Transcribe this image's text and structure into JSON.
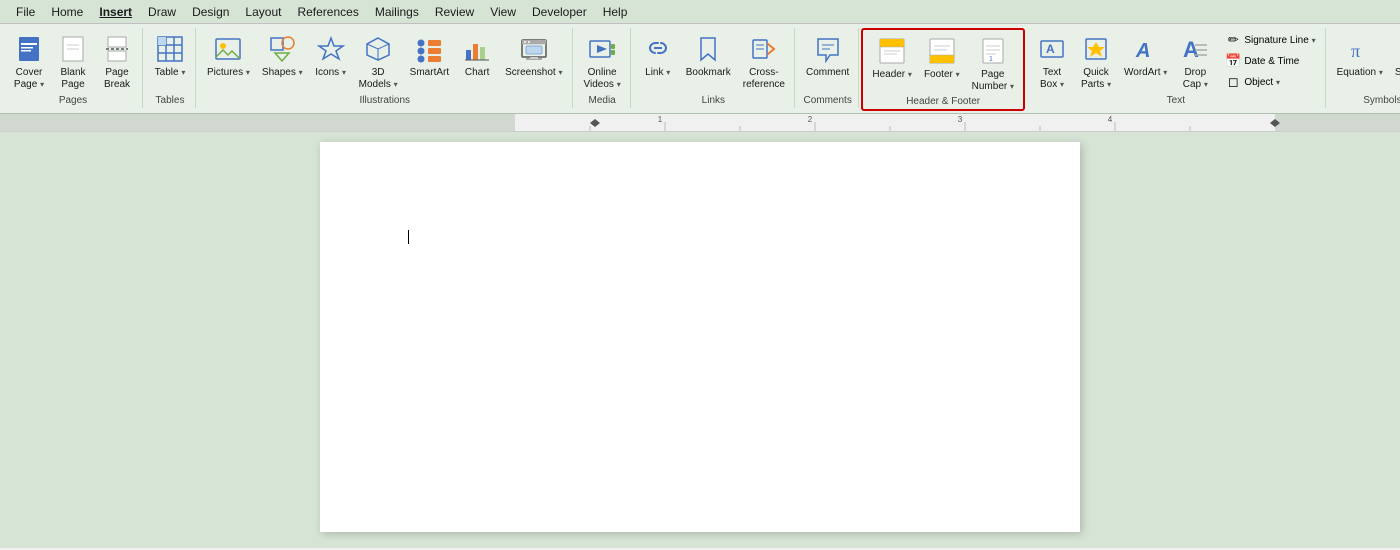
{
  "menu": {
    "items": [
      "File",
      "Home",
      "Insert",
      "Draw",
      "Design",
      "Layout",
      "References",
      "Mailings",
      "Review",
      "View",
      "Developer",
      "Help"
    ],
    "active_index": 2
  },
  "ribbon": {
    "groups": [
      {
        "name": "Pages",
        "label": "Pages",
        "buttons": [
          {
            "id": "cover-page",
            "label": "Cover\nPage",
            "icon": "📄",
            "dropdown": true
          },
          {
            "id": "blank-page",
            "label": "Blank\nPage",
            "icon": "📃",
            "dropdown": false
          },
          {
            "id": "page-break",
            "label": "Page\nBreak",
            "icon": "📋",
            "dropdown": false
          }
        ]
      },
      {
        "name": "Tables",
        "label": "Tables",
        "buttons": [
          {
            "id": "table",
            "label": "Table",
            "icon": "⊞",
            "dropdown": true
          }
        ]
      },
      {
        "name": "Illustrations",
        "label": "Illustrations",
        "buttons": [
          {
            "id": "pictures",
            "label": "Pictures",
            "icon": "🖼",
            "dropdown": true
          },
          {
            "id": "shapes",
            "label": "Shapes",
            "icon": "⬟",
            "dropdown": true
          },
          {
            "id": "icons",
            "label": "Icons",
            "icon": "★",
            "dropdown": true
          },
          {
            "id": "3d-models",
            "label": "3D\nModels",
            "icon": "🎲",
            "dropdown": true
          },
          {
            "id": "smartart",
            "label": "SmartArt",
            "icon": "🔷",
            "dropdown": false
          },
          {
            "id": "chart",
            "label": "Chart",
            "icon": "📊",
            "dropdown": false
          },
          {
            "id": "screenshot",
            "label": "Screenshot",
            "icon": "📷",
            "dropdown": true
          }
        ]
      },
      {
        "name": "Media",
        "label": "Media",
        "buttons": [
          {
            "id": "online-videos",
            "label": "Online\nVideos",
            "icon": "▶",
            "dropdown": true
          }
        ]
      },
      {
        "name": "Links",
        "label": "Links",
        "buttons": [
          {
            "id": "link",
            "label": "Link",
            "icon": "🔗",
            "dropdown": true
          },
          {
            "id": "bookmark",
            "label": "Bookmark",
            "icon": "🔖",
            "dropdown": false
          },
          {
            "id": "cross-reference",
            "label": "Cross-\nreference",
            "icon": "↗",
            "dropdown": false
          }
        ]
      },
      {
        "name": "Comments",
        "label": "Comments",
        "buttons": [
          {
            "id": "comment",
            "label": "Comment",
            "icon": "💬",
            "dropdown": false
          }
        ]
      },
      {
        "name": "Header & Footer",
        "label": "Header & Footer",
        "highlighted": true,
        "buttons": [
          {
            "id": "header",
            "label": "Header",
            "icon": "⬜",
            "dropdown": true
          },
          {
            "id": "footer",
            "label": "Footer",
            "icon": "⬜",
            "dropdown": true
          },
          {
            "id": "page-number",
            "label": "Page\nNumber",
            "icon": "#",
            "dropdown": true
          }
        ]
      },
      {
        "name": "Text",
        "label": "Text",
        "buttons": [
          {
            "id": "text-box",
            "label": "Text\nBox",
            "icon": "📝",
            "dropdown": true
          },
          {
            "id": "quick-parts",
            "label": "Quick\nParts",
            "icon": "⚡",
            "dropdown": true
          },
          {
            "id": "wordart",
            "label": "WordArt",
            "icon": "A",
            "dropdown": true
          },
          {
            "id": "drop-cap",
            "label": "Drop\nCap",
            "icon": "A",
            "dropdown": true
          }
        ],
        "small_buttons": [
          {
            "id": "signature-line",
            "label": "Signature Line",
            "icon": "✏"
          },
          {
            "id": "date-time",
            "label": "Date & Time",
            "icon": "📅"
          },
          {
            "id": "object",
            "label": "Object",
            "icon": "◻"
          }
        ]
      },
      {
        "name": "Symbols",
        "label": "Symbols",
        "buttons": [
          {
            "id": "equation",
            "label": "Equation",
            "icon": "π",
            "dropdown": true
          },
          {
            "id": "symbol",
            "label": "Symbol",
            "icon": "Ω",
            "dropdown": false
          }
        ]
      }
    ]
  },
  "document": {
    "background_color": "#d6e4d6",
    "page_color": "#ffffff"
  }
}
